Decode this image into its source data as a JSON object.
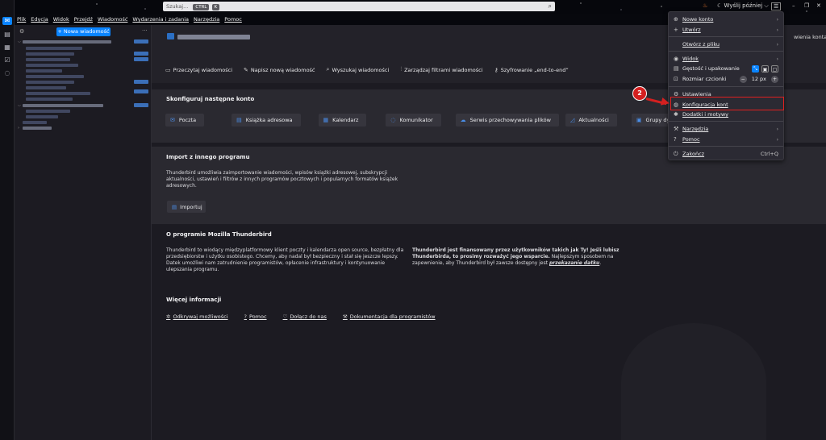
{
  "search": {
    "placeholder": "Szukaj...",
    "shortcut_mod": "CTRL",
    "shortcut_key": "K"
  },
  "titlebar": {
    "send_later": "Wyślij później"
  },
  "menubar": [
    "Plik",
    "Edycja",
    "Widok",
    "Przejdź",
    "Wiadomość",
    "Wydarzenia i zadania",
    "Narzędzia",
    "Pomoc"
  ],
  "folder_pane": {
    "new_message": "+ Nowa wiadomość"
  },
  "main": {
    "actions": [
      "Przeczytaj wiadomości",
      "Napisz nową wiadomość",
      "Wyszukaj wiadomości",
      "Zarządzaj filtrami wiadomości",
      "Szyfrowanie „end-to-end”"
    ],
    "setup_title": "Skonfiguruj następne konto",
    "account_types": [
      "Poczta",
      "Książka adresowa",
      "Kalendarz",
      "Komunikator",
      "Serwis przechowywania plików",
      "Aktualności",
      "Grupy dy"
    ],
    "import_title": "Import z innego programu",
    "import_text": "Thunderbird umożliwia zaimportowanie wiadomości, wpisów książki adresowej, subskrypcji aktualności, ustawień i filtrów z innych programów pocztowych i popularnych formatów książek adresowych.",
    "import_button": "Importuj",
    "about_title": "O programie Mozilla Thunderbird",
    "about_text": "Thunderbird to wiodący międzyplatformowy klient poczty i kalendarza open source, bezpłatny dla przedsiębiorstw i użytku osobistego. Chcemy, aby nadal był bezpieczny i stał się jeszcze lepszy. Datek umożliwi nam zatrudnienie programistów, opłacenie infrastruktury i kontynuowanie ulepszania programu.",
    "donate_bold": "Thunderbird jest finansowany przez użytkowników takich jak Ty! Jeśli lubisz Thunderbirda, to prosimy rozważyć jego wsparcie.",
    "donate_text": "Najlepszym sposobem na zapewnienie, aby Thunderbird był zawsze dostępny jest",
    "donate_link": "przekazanie datku",
    "more_info_title": "Więcej informacji",
    "more_links": [
      "Odkrywaj możliwości",
      "Pomoc",
      "Dołącz do nas",
      "Dokumentacja dla programistów"
    ],
    "right_edge_text": "wienia konta"
  },
  "app_menu": {
    "new_account": "Nowe konto",
    "create": "Utwórz",
    "open_file": "Otwórz z pliku",
    "view": "Widok",
    "density": "Gęstość i upakowanie",
    "font_size_label": "Rozmiar czcionki",
    "font_size_value": "12 px",
    "settings": "Ustawienia",
    "account_settings": "Konfiguracja kont",
    "addons": "Dodatki i motywy",
    "tools": "Narzędzia",
    "help": "Pomoc",
    "quit": "Zakończ",
    "quit_shortcut": "Ctrl+Q"
  },
  "annotation": {
    "step": "2",
    "color": "#d42020"
  },
  "colors": {
    "accent": "#0a84ff",
    "background": "#1c1b22"
  }
}
